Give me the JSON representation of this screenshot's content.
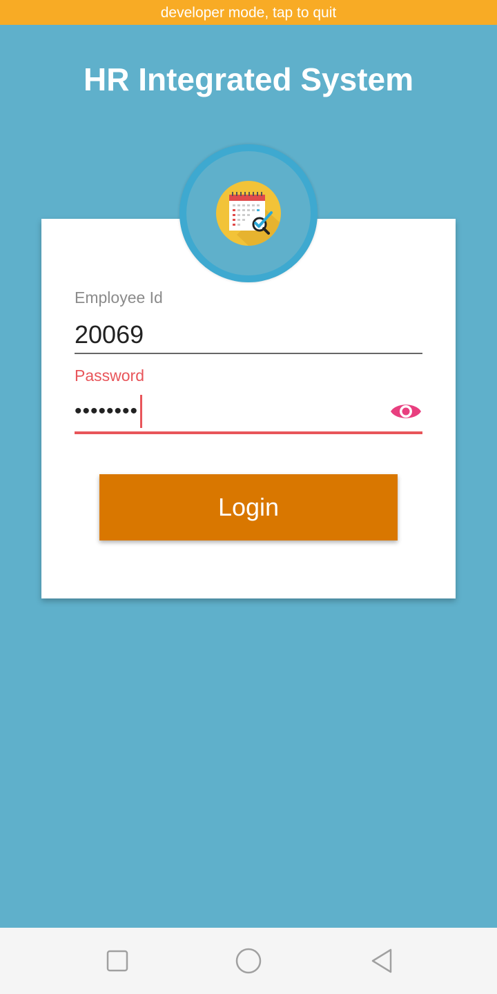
{
  "banner": {
    "text": "developer mode, tap to quit",
    "color": "#f8ab25"
  },
  "header": {
    "title": "HR Integrated System"
  },
  "logo": {
    "icon": "calendar-search-icon"
  },
  "form": {
    "employee_id": {
      "label": "Employee Id",
      "value": "20069"
    },
    "password": {
      "label": "Password",
      "value": "••••••••",
      "toggle_icon": "eye-icon",
      "focused": true
    },
    "login_button": {
      "label": "Login"
    }
  },
  "navigation": {
    "recents_icon": "square-recents-icon",
    "home_icon": "circle-home-icon",
    "back_icon": "triangle-back-icon"
  },
  "colors": {
    "background": "#5fb0cb",
    "banner": "#f8ab25",
    "accent_error": "#e8555a",
    "eye_icon": "#e83f7f",
    "button": "#d97700",
    "logo_ring": "#3ea9d0"
  }
}
